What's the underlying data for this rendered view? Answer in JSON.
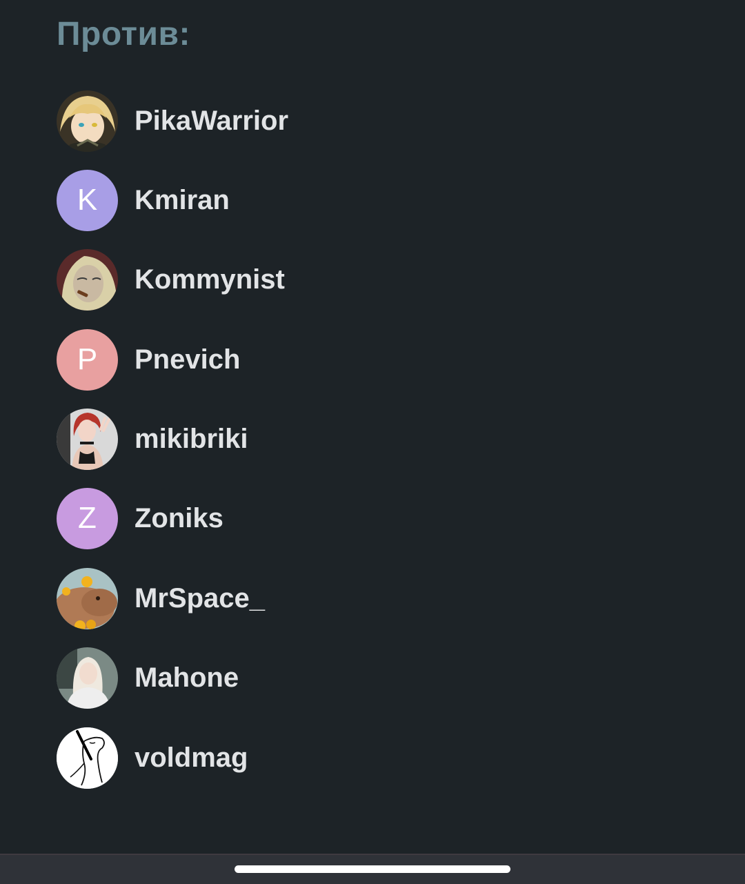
{
  "heading": "Против:",
  "voters": [
    {
      "username": "PikaWarrior",
      "avatar_type": "image",
      "avatar_icon": "anime-blonde-character-avatar"
    },
    {
      "username": "Kmiran",
      "avatar_type": "letter",
      "avatar_letter": "K",
      "avatar_color": "#a89ee6"
    },
    {
      "username": "Kommynist",
      "avatar_type": "image",
      "avatar_icon": "anime-character-with-cigar-avatar"
    },
    {
      "username": "Pnevich",
      "avatar_type": "letter",
      "avatar_letter": "P",
      "avatar_color": "#e8a0a0"
    },
    {
      "username": "mikibriki",
      "avatar_type": "image",
      "avatar_icon": "red-haired-woman-avatar"
    },
    {
      "username": "Zoniks",
      "avatar_type": "letter",
      "avatar_letter": "Z",
      "avatar_color": "#c89be0"
    },
    {
      "username": "MrSpace_",
      "avatar_type": "image",
      "avatar_icon": "capybara-with-oranges-avatar"
    },
    {
      "username": "Mahone",
      "avatar_type": "image",
      "avatar_icon": "blonde-woman-avatar"
    },
    {
      "username": "voldmag",
      "avatar_type": "image",
      "avatar_icon": "line-sketch-avatar"
    }
  ]
}
